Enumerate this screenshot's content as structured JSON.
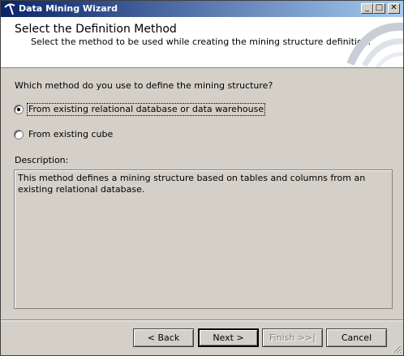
{
  "window": {
    "title": "Data Mining Wizard"
  },
  "header": {
    "title": "Select the Definition Method",
    "subtitle": "Select the method to be used while creating the mining structure definition."
  },
  "form": {
    "question": "Which method do you use to define the mining structure?",
    "options": [
      {
        "label": "From existing relational database or data warehouse",
        "selected": true
      },
      {
        "label": "From existing cube",
        "selected": false
      }
    ],
    "description_label": "Description:",
    "description_text": "This method defines a mining structure based on tables and columns from an existing relational database."
  },
  "buttons": {
    "back": "< Back",
    "next": "Next >",
    "finish": "Finish >>|",
    "cancel": "Cancel"
  },
  "icons": {
    "app": "pickaxe-icon",
    "minimize": "minimize-icon",
    "maximize": "maximize-icon",
    "close": "close-icon",
    "header_art": "swoosh-icon",
    "grip": "resize-grip-icon"
  },
  "colors": {
    "title_start": "#0a246a",
    "title_end": "#a6caf0",
    "face": "#d4d0c8",
    "header_bg": "#ffffff"
  }
}
